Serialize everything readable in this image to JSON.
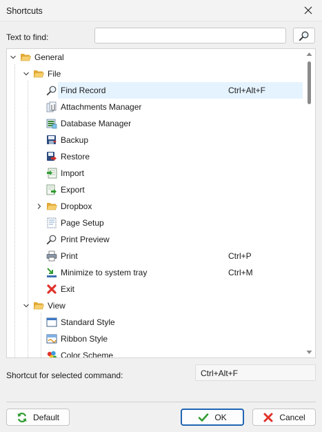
{
  "window": {
    "title": "Shortcuts"
  },
  "search": {
    "label": "Text to find:",
    "value": "",
    "placeholder": ""
  },
  "tree": {
    "rows": [
      {
        "label": "General",
        "shortcut": "",
        "icon": "folder-open-icon"
      },
      {
        "label": "File",
        "shortcut": "",
        "icon": "folder-open-icon"
      },
      {
        "label": "Find Record",
        "shortcut": "Ctrl+Alt+F",
        "icon": "magnifier-icon",
        "selected": true
      },
      {
        "label": "Attachments Manager",
        "shortcut": "",
        "icon": "attachment-icon"
      },
      {
        "label": "Database Manager",
        "shortcut": "",
        "icon": "database-icon"
      },
      {
        "label": "Backup",
        "shortcut": "",
        "icon": "backup-icon"
      },
      {
        "label": "Restore",
        "shortcut": "",
        "icon": "restore-icon"
      },
      {
        "label": "Import",
        "shortcut": "",
        "icon": "import-icon"
      },
      {
        "label": "Export",
        "shortcut": "",
        "icon": "export-icon"
      },
      {
        "label": "Dropbox",
        "shortcut": "",
        "icon": "folder-icon"
      },
      {
        "label": "Page Setup",
        "shortcut": "",
        "icon": "page-setup-icon"
      },
      {
        "label": "Print Preview",
        "shortcut": "",
        "icon": "print-preview-icon"
      },
      {
        "label": "Print",
        "shortcut": "Ctrl+P",
        "icon": "printer-icon"
      },
      {
        "label": "Minimize to system tray",
        "shortcut": "Ctrl+M",
        "icon": "minimize-tray-icon"
      },
      {
        "label": "Exit",
        "shortcut": "",
        "icon": "exit-icon"
      },
      {
        "label": "View",
        "shortcut": "",
        "icon": "folder-open-icon"
      },
      {
        "label": "Standard Style",
        "shortcut": "",
        "icon": "window-icon"
      },
      {
        "label": "Ribbon Style",
        "shortcut": "",
        "icon": "ribbon-icon"
      },
      {
        "label": "Color Scheme",
        "shortcut": "",
        "icon": "palette-icon"
      }
    ]
  },
  "shortcut_field": {
    "label": "Shortcut for selected command:",
    "value": "Ctrl+Alt+F"
  },
  "buttons": {
    "default": "Default",
    "ok": "OK",
    "cancel": "Cancel"
  },
  "colors": {
    "selection": "#e5f3ff",
    "primary_border": "#1f64b4",
    "folder": "#f2c25b"
  }
}
